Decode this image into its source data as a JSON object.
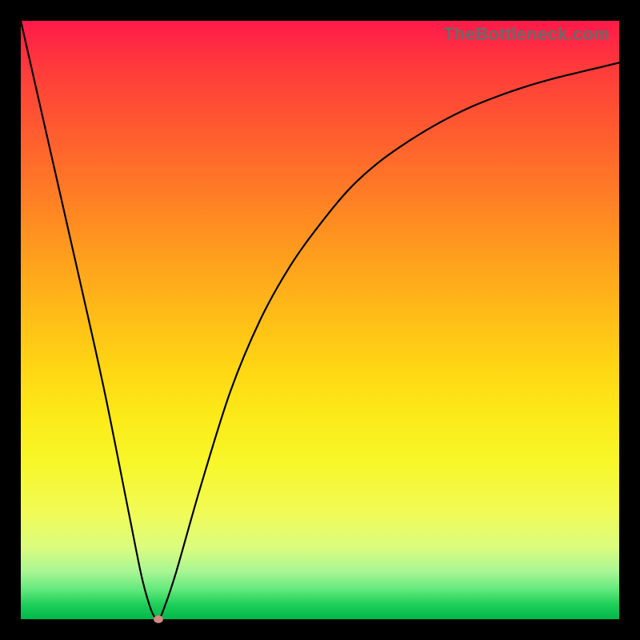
{
  "watermark": "TheBottleneck.com",
  "colors": {
    "frame": "#000000",
    "curve": "#000000",
    "marker": "#d58a84"
  },
  "chart_data": {
    "type": "line",
    "title": "",
    "xlabel": "",
    "ylabel": "",
    "xlim": [
      0,
      100
    ],
    "ylim": [
      0,
      100
    ],
    "grid": false,
    "legend": false,
    "annotations": [
      {
        "text": "TheBottleneck.com",
        "position": "top-right"
      }
    ],
    "series": [
      {
        "name": "bottleneck-curve",
        "x": [
          0,
          5,
          10,
          14,
          18,
          20,
          21,
          22,
          23,
          24,
          26,
          30,
          35,
          40,
          45,
          50,
          55,
          60,
          65,
          70,
          75,
          80,
          85,
          90,
          95,
          100
        ],
        "y": [
          100,
          78,
          56,
          38,
          18,
          8,
          4,
          1,
          0,
          2,
          8,
          22,
          38,
          50,
          59,
          66,
          72,
          76.5,
          80,
          83,
          85.5,
          87.5,
          89.2,
          90.6,
          91.8,
          93
        ]
      }
    ],
    "marker": {
      "x": 23,
      "y": 0
    }
  }
}
